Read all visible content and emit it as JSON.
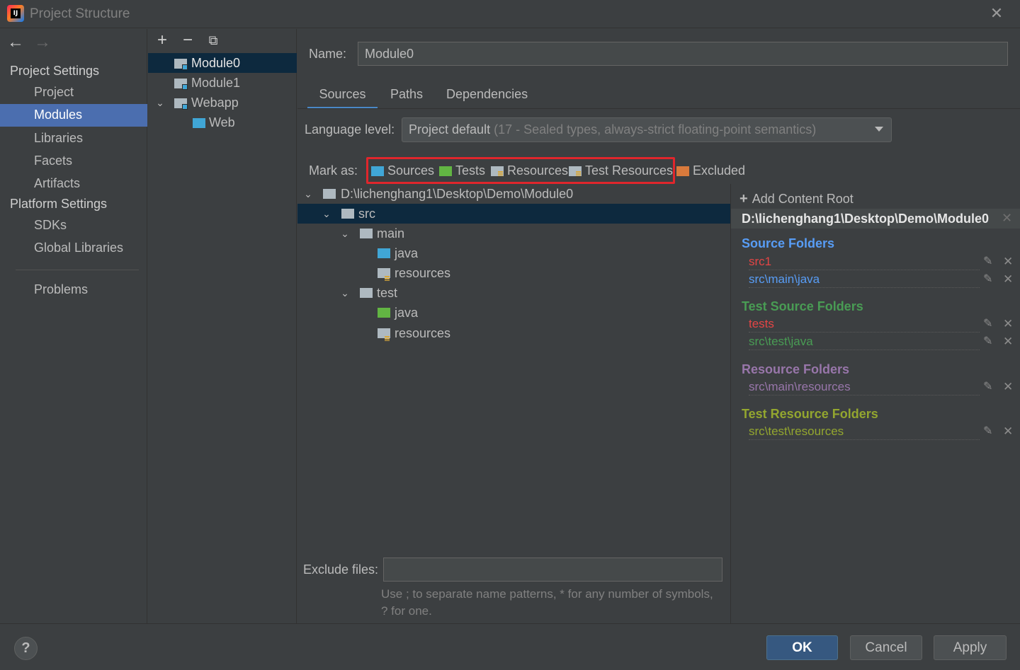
{
  "window": {
    "title": "Project Structure",
    "logo_text": "IJ"
  },
  "nav": {
    "back_icon": "arrow-left-icon",
    "forward_icon": "arrow-right-icon",
    "project_settings": "Project Settings",
    "project_items": [
      "Project",
      "Modules",
      "Libraries",
      "Facets",
      "Artifacts"
    ],
    "platform_settings": "Platform Settings",
    "platform_items": [
      "SDKs",
      "Global Libraries"
    ],
    "problems": "Problems",
    "selected": "Modules"
  },
  "modules": {
    "toolbar": [
      "add-icon",
      "remove-icon",
      "copy-icon"
    ],
    "items": [
      "Module0",
      "Module1",
      "Webapp",
      "Web"
    ],
    "selected": "Module0"
  },
  "main": {
    "name_label": "Name:",
    "name_value": "Module0",
    "tabs": [
      "Sources",
      "Paths",
      "Dependencies"
    ],
    "active_tab": "Sources",
    "language_label": "Language level:",
    "language_value": "Project default",
    "language_detail": "(17 - Sealed types, always-strict floating-point semantics)",
    "mark_as_label": "Mark as:",
    "mark_as": [
      "Sources",
      "Tests",
      "Resources",
      "Test Resources",
      "Excluded"
    ],
    "tree": [
      "D:\\lichenghang1\\Desktop\\Demo\\Module0",
      "src",
      "main",
      "java",
      "resources",
      "test",
      "java",
      "resources"
    ],
    "exclude_label": "Exclude files:",
    "exclude_value": "",
    "exclude_hint": "Use ; to separate name patterns, * for any number of symbols, ? for one."
  },
  "roots": {
    "add_label": "Add Content Root",
    "path": "D:\\lichenghang1\\Desktop\\Demo\\Module0",
    "source_title": "Source Folders",
    "source_items": [
      "src1",
      "src\\main\\java"
    ],
    "test_title": "Test Source Folders",
    "test_items": [
      "tests",
      "src\\test\\java"
    ],
    "resource_title": "Resource Folders",
    "resource_items": [
      "src\\main\\resources"
    ],
    "test_resource_title": "Test Resource Folders",
    "test_resource_items": [
      "src\\test\\resources"
    ],
    "colors": {
      "source": "#589df6",
      "test": "#499c54",
      "resource": "#9876aa",
      "test_resource": "#93a62f",
      "missing": "#e44545"
    }
  },
  "footer": {
    "help": "?",
    "ok": "OK",
    "cancel": "Cancel",
    "apply": "Apply"
  }
}
